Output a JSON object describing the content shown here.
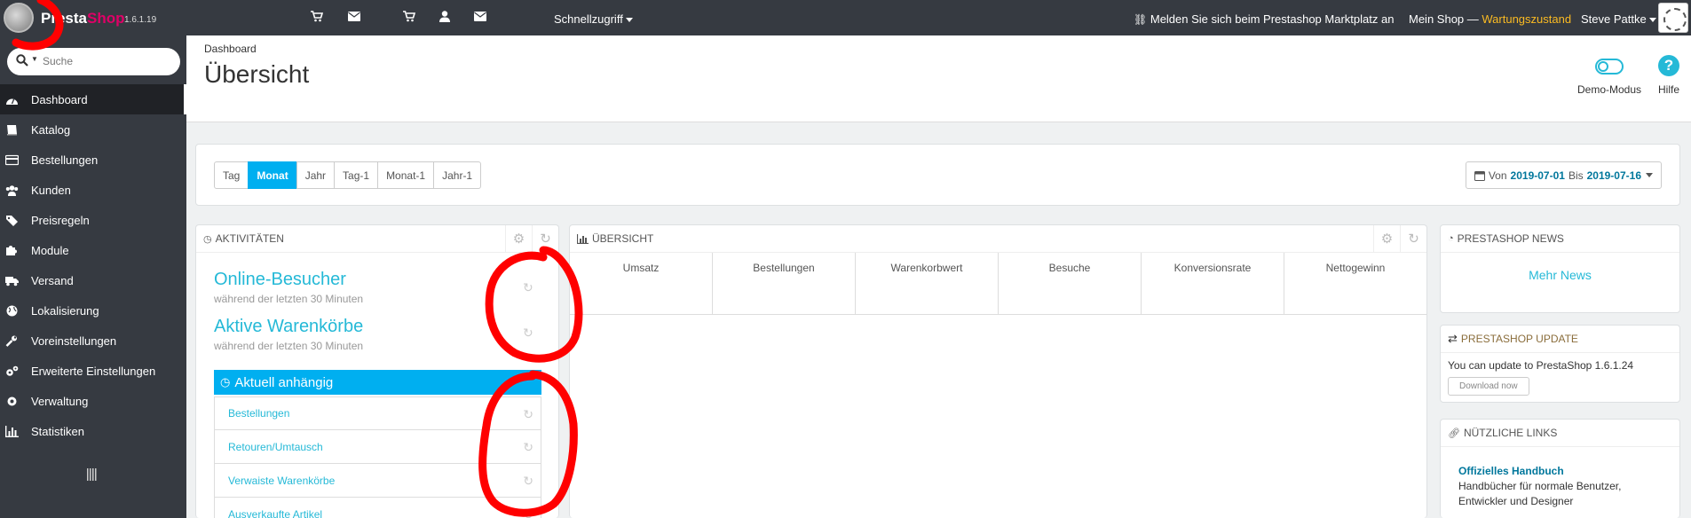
{
  "app": {
    "logo_presta": "Presta",
    "logo_shop": "Shop",
    "version": "1.6.1.19"
  },
  "topbar": {
    "icons": [
      "cart-icon",
      "envelope-icon",
      "cart-icon",
      "user-icon",
      "envelope-icon"
    ],
    "quick_access": "Schnellzugriff",
    "marketplace": "Melden Sie sich beim Prestashop Marktplatz an",
    "shop_name": "Mein Shop — ",
    "maintenance": "Wartungszustand",
    "user": "Steve Pattke"
  },
  "sidebar": {
    "search_placeholder": "Suche",
    "items": [
      {
        "label": "Dashboard",
        "icon": "dashboard-icon",
        "active": true
      },
      {
        "label": "Katalog",
        "icon": "book-icon"
      },
      {
        "label": "Bestellungen",
        "icon": "credit-card-icon"
      },
      {
        "label": "Kunden",
        "icon": "users-icon"
      },
      {
        "label": "Preisregeln",
        "icon": "tags-icon"
      },
      {
        "label": "Module",
        "icon": "puzzle-icon"
      },
      {
        "label": "Versand",
        "icon": "truck-icon"
      },
      {
        "label": "Lokalisierung",
        "icon": "globe-icon"
      },
      {
        "label": "Voreinstellungen",
        "icon": "wrench-icon"
      },
      {
        "label": "Erweiterte Einstellungen",
        "icon": "cogs-icon"
      },
      {
        "label": "Verwaltung",
        "icon": "cog-icon"
      },
      {
        "label": "Statistiken",
        "icon": "bar-chart-icon"
      }
    ]
  },
  "header": {
    "breadcrumb": "Dashboard",
    "title": "Übersicht",
    "demo_mode": "Demo-Modus",
    "help": "Hilfe"
  },
  "period": {
    "buttons": [
      "Tag",
      "Monat",
      "Jahr",
      "Tag-1",
      "Monat-1",
      "Jahr-1"
    ],
    "active": "Monat",
    "from_label": "Von",
    "from": "2019-07-01",
    "to_label": "Bis",
    "to": "2019-07-16"
  },
  "activities": {
    "heading": "Aktivitäten",
    "online_title": "Online-Besucher",
    "online_sub": "während der letzten 30 Minuten",
    "carts_title": "Aktive Warenkörbe",
    "carts_sub": "während der letzten 30 Minuten",
    "pending_heading": "Aktuell anhängig",
    "pending_items": [
      "Bestellungen",
      "Retouren/Umtausch",
      "Verwaiste Warenkörbe",
      "Ausverkaufte Artikel"
    ]
  },
  "overview": {
    "heading": "Übersicht",
    "kpis": [
      "Umsatz",
      "Bestellungen",
      "Warenkorbwert",
      "Besuche",
      "Konversionsrate",
      "Nettogewinn"
    ]
  },
  "news": {
    "heading": "Prestashop News",
    "more": "Mehr News"
  },
  "update": {
    "heading": "Prestashop Update",
    "text": "You can update to PrestaShop 1.6.1.24",
    "download": "Download now"
  },
  "links": {
    "heading": "Nützliche Links",
    "title": "Offizielles Handbuch",
    "desc": "Handbücher für normale Benutzer, Entwickler und Designer"
  },
  "colors": {
    "accent": "#25b9d7",
    "active_button": "#00aff0",
    "maintenance": "#fbbb22",
    "annotation": "#ff0000"
  }
}
